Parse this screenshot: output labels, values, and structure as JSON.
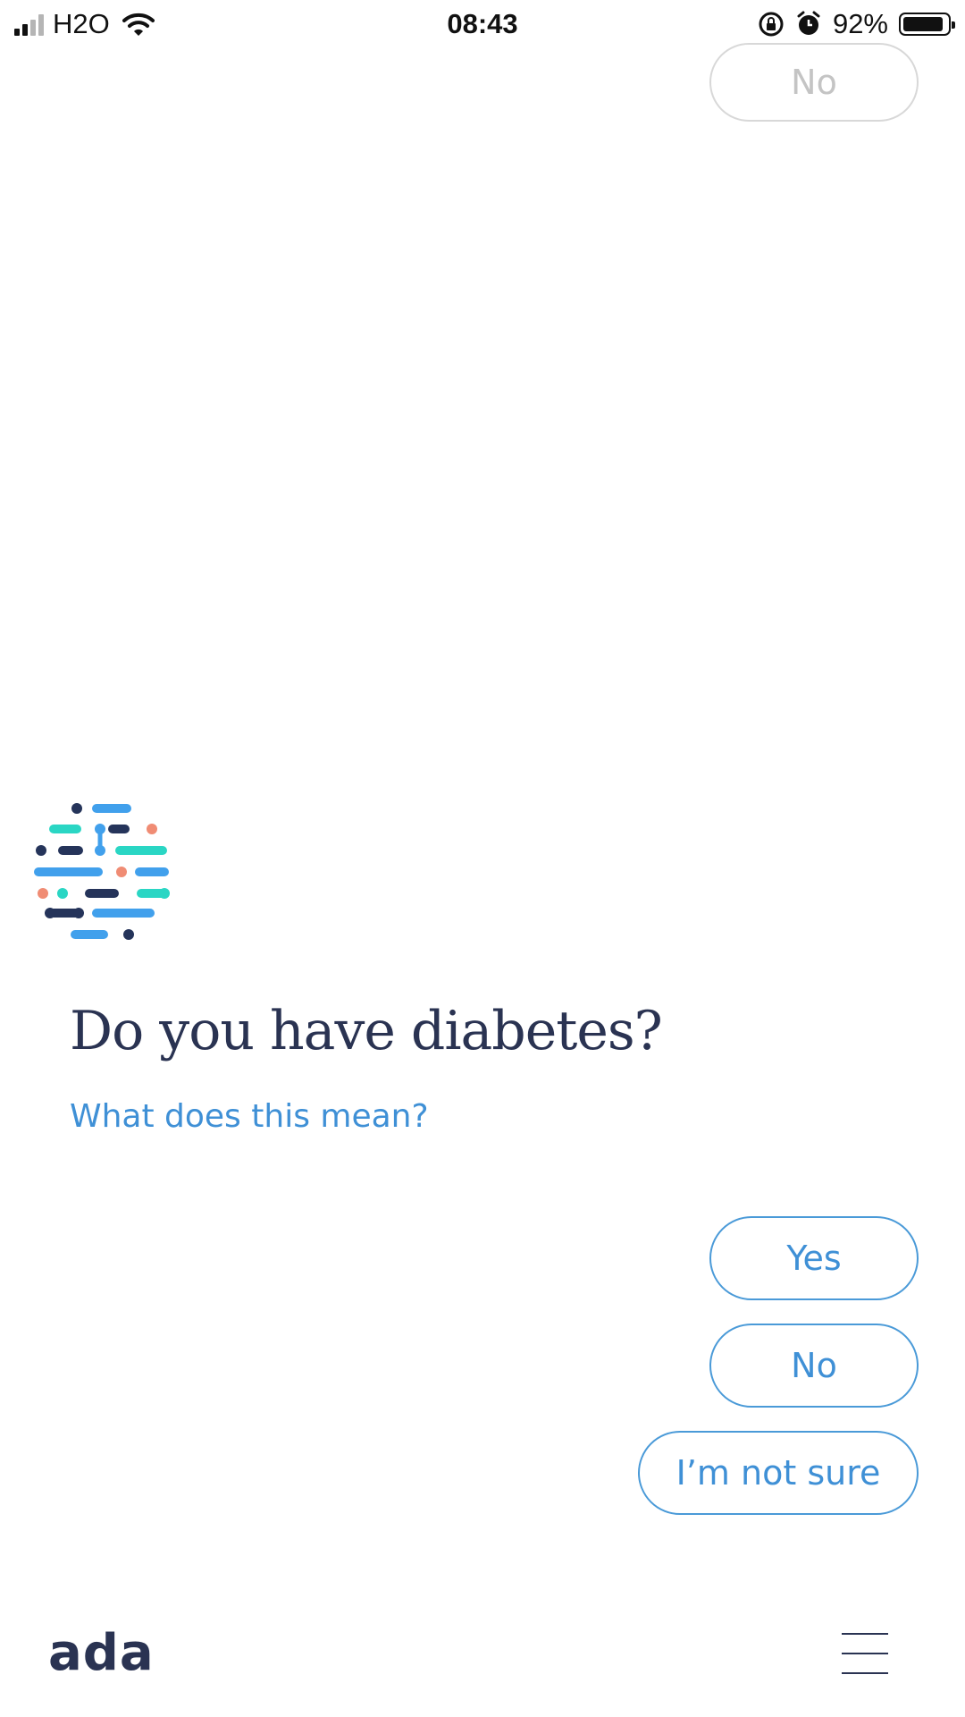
{
  "status_bar": {
    "carrier": "H2O",
    "time": "08:43",
    "battery": "92%",
    "battery_level": 0.92
  },
  "previous_answer": {
    "label": "No"
  },
  "question": {
    "title": "Do you have diabetes?",
    "help_link": "What does this mean?"
  },
  "answers": {
    "yes": "Yes",
    "no": "No",
    "not_sure": "I’m not sure"
  },
  "footer": {
    "brand": "ada"
  },
  "colors": {
    "accent": "#3f90d6",
    "heading": "#2a3352",
    "logo_light_blue": "#41a0ec",
    "logo_teal": "#2ad6c4",
    "logo_navy": "#25345a",
    "logo_salmon": "#f08c74"
  },
  "icons": [
    "signal-icon",
    "wifi-icon",
    "rotation-lock-icon",
    "alarm-icon",
    "battery-icon",
    "ada-logo-mark",
    "menu-icon"
  ]
}
